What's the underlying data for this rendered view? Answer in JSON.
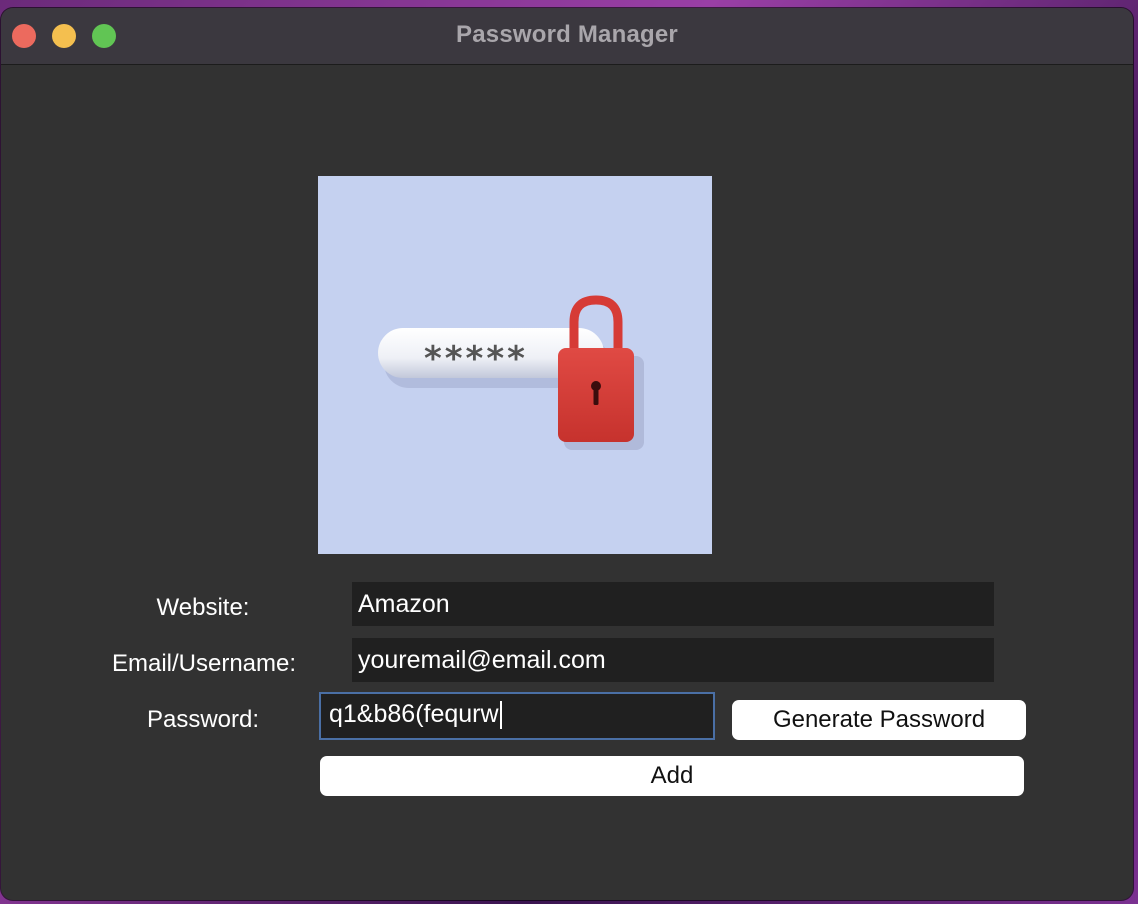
{
  "window": {
    "title": "Password Manager",
    "traffic_lights": {
      "close_color": "#ec6a5e",
      "minimize_color": "#f4bf4f",
      "maximize_color": "#61c554"
    }
  },
  "logo": {
    "icon": "password-lock-icon",
    "mask_text": "*****",
    "background_color": "#c5d1f0",
    "lock_color": "#d63b36"
  },
  "form": {
    "website_label": "Website:",
    "website_value": "Amazon",
    "email_label": "Email/Username:",
    "email_value": "youremail@email.com",
    "password_label": "Password:",
    "password_value": "q1&b86(fequrw",
    "generate_button_label": "Generate Password",
    "add_button_label": "Add"
  }
}
